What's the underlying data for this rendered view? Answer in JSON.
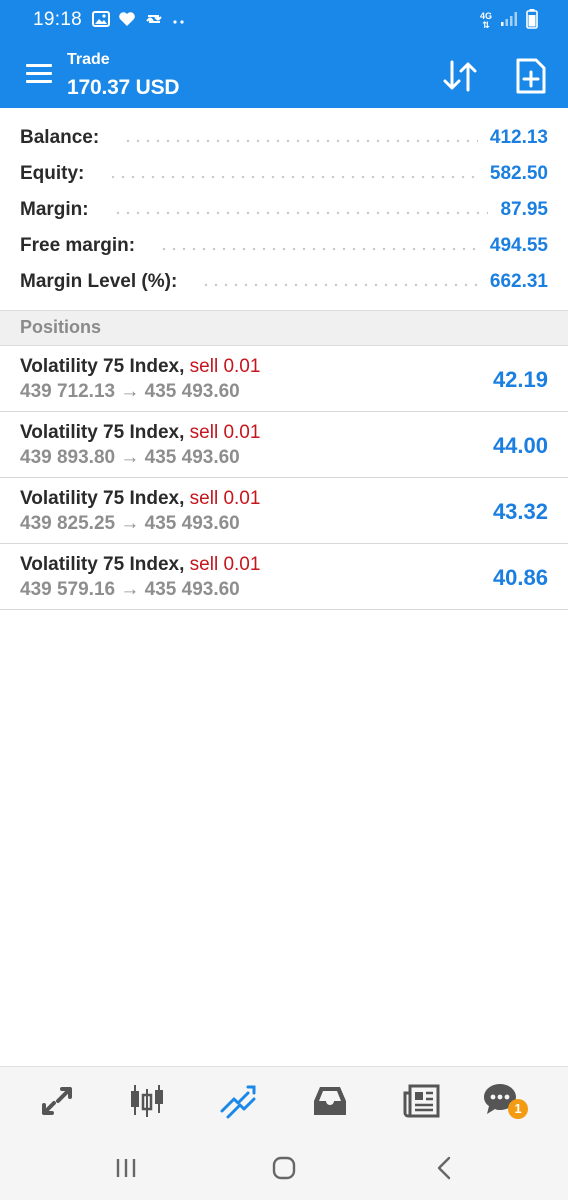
{
  "status_bar": {
    "time": "19:18",
    "network_type": "4G",
    "left_icons": [
      "image-icon",
      "heart-icon",
      "sync-icon",
      "more-dots-icon"
    ],
    "right_icons": [
      "network-4g-icon",
      "signal-icon",
      "battery-icon"
    ]
  },
  "app_bar": {
    "title": "Trade",
    "subtitle": "170.37 USD",
    "actions": [
      "sort-icon",
      "new-order-icon"
    ]
  },
  "summary": [
    {
      "label": "Balance:",
      "value": "412.13"
    },
    {
      "label": "Equity:",
      "value": "582.50"
    },
    {
      "label": "Margin:",
      "value": "87.95"
    },
    {
      "label": "Free margin:",
      "value": "494.55"
    },
    {
      "label": "Margin Level (%):",
      "value": "662.31"
    }
  ],
  "positions_section": {
    "header": "Positions",
    "items": [
      {
        "symbol": "Volatility 75 Index,",
        "type": "sell 0.01",
        "prices": "439 712.13 → 435 493.60",
        "profit": "42.19"
      },
      {
        "symbol": "Volatility 75 Index,",
        "type": "sell 0.01",
        "prices": "439 893.80 → 435 493.60",
        "profit": "44.00"
      },
      {
        "symbol": "Volatility 75 Index,",
        "type": "sell 0.01",
        "prices": "439 825.25 → 435 493.60",
        "profit": "43.32"
      },
      {
        "symbol": "Volatility 75 Index,",
        "type": "sell 0.01",
        "prices": "439 579.16 → 435 493.60",
        "profit": "40.86"
      }
    ]
  },
  "bottom_nav": {
    "items": [
      "quotes-icon",
      "chart-icon",
      "trade-icon",
      "history-icon",
      "news-icon",
      "chat-icon"
    ],
    "active": "trade-icon",
    "chat_badge": "1"
  },
  "system_nav": [
    "recent-apps-icon",
    "home-icon",
    "back-icon"
  ],
  "colors": {
    "app_bar": "#1a88e8",
    "value_blue": "#1a7fe0",
    "sell_red": "#c5161d",
    "muted_gray": "#8e8e8e",
    "badge_orange": "#f39c12"
  }
}
